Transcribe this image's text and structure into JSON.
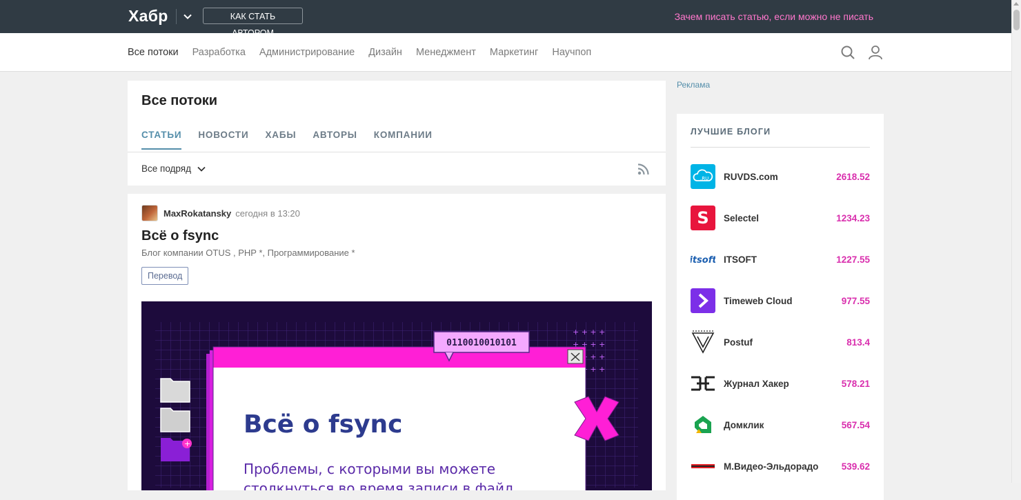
{
  "header": {
    "logo": "Хабр",
    "become_author": "КАК СТАТЬ АВТОРОМ",
    "promo": "Зачем писать статью, если можно не писать"
  },
  "nav": {
    "items": [
      "Все потоки",
      "Разработка",
      "Администрирование",
      "Дизайн",
      "Менеджмент",
      "Маркетинг",
      "Научпоп"
    ]
  },
  "feed": {
    "title": "Все потоки",
    "tabs": [
      "СТАТЬИ",
      "НОВОСТИ",
      "ХАБЫ",
      "АВТОРЫ",
      "КОМПАНИИ"
    ],
    "filter": "Все подряд"
  },
  "article": {
    "author": "MaxRokatansky",
    "time": "сегодня в 13:20",
    "title": "Всё о fsync",
    "hubs": "Блог компании OTUS , PHP *, Программирование *",
    "badge": "Перевод",
    "cover": {
      "binary": "0110010010101",
      "heading": "Всё о fsync",
      "subtitle_line1": "Проблемы, с которыми вы можете",
      "subtitle_line2": "столкнуться во время записи в файл"
    }
  },
  "sidebar": {
    "ad": "Реклама",
    "blogs_title": "ЛУЧШИЕ БЛОГИ",
    "blogs": [
      {
        "name": "RUVDS.com",
        "score": "2618.52",
        "color": "#00b0e0"
      },
      {
        "name": "Selectel",
        "score": "1234.23",
        "color": "#e8153d"
      },
      {
        "name": "ITSOFT",
        "score": "1227.55",
        "color": "#1c5fb0"
      },
      {
        "name": "Timeweb Cloud",
        "score": "977.55",
        "color": "#7c2fe8"
      },
      {
        "name": "Postuf",
        "score": "813.4",
        "color": "#222222"
      },
      {
        "name": "Журнал Хакер",
        "score": "578.21",
        "color": "#222222"
      },
      {
        "name": "Домклик",
        "score": "567.54",
        "color": "#1aa350"
      },
      {
        "name": "М.Видео-Эльдорадо",
        "score": "539.62",
        "color": "#e31e24"
      }
    ]
  }
}
